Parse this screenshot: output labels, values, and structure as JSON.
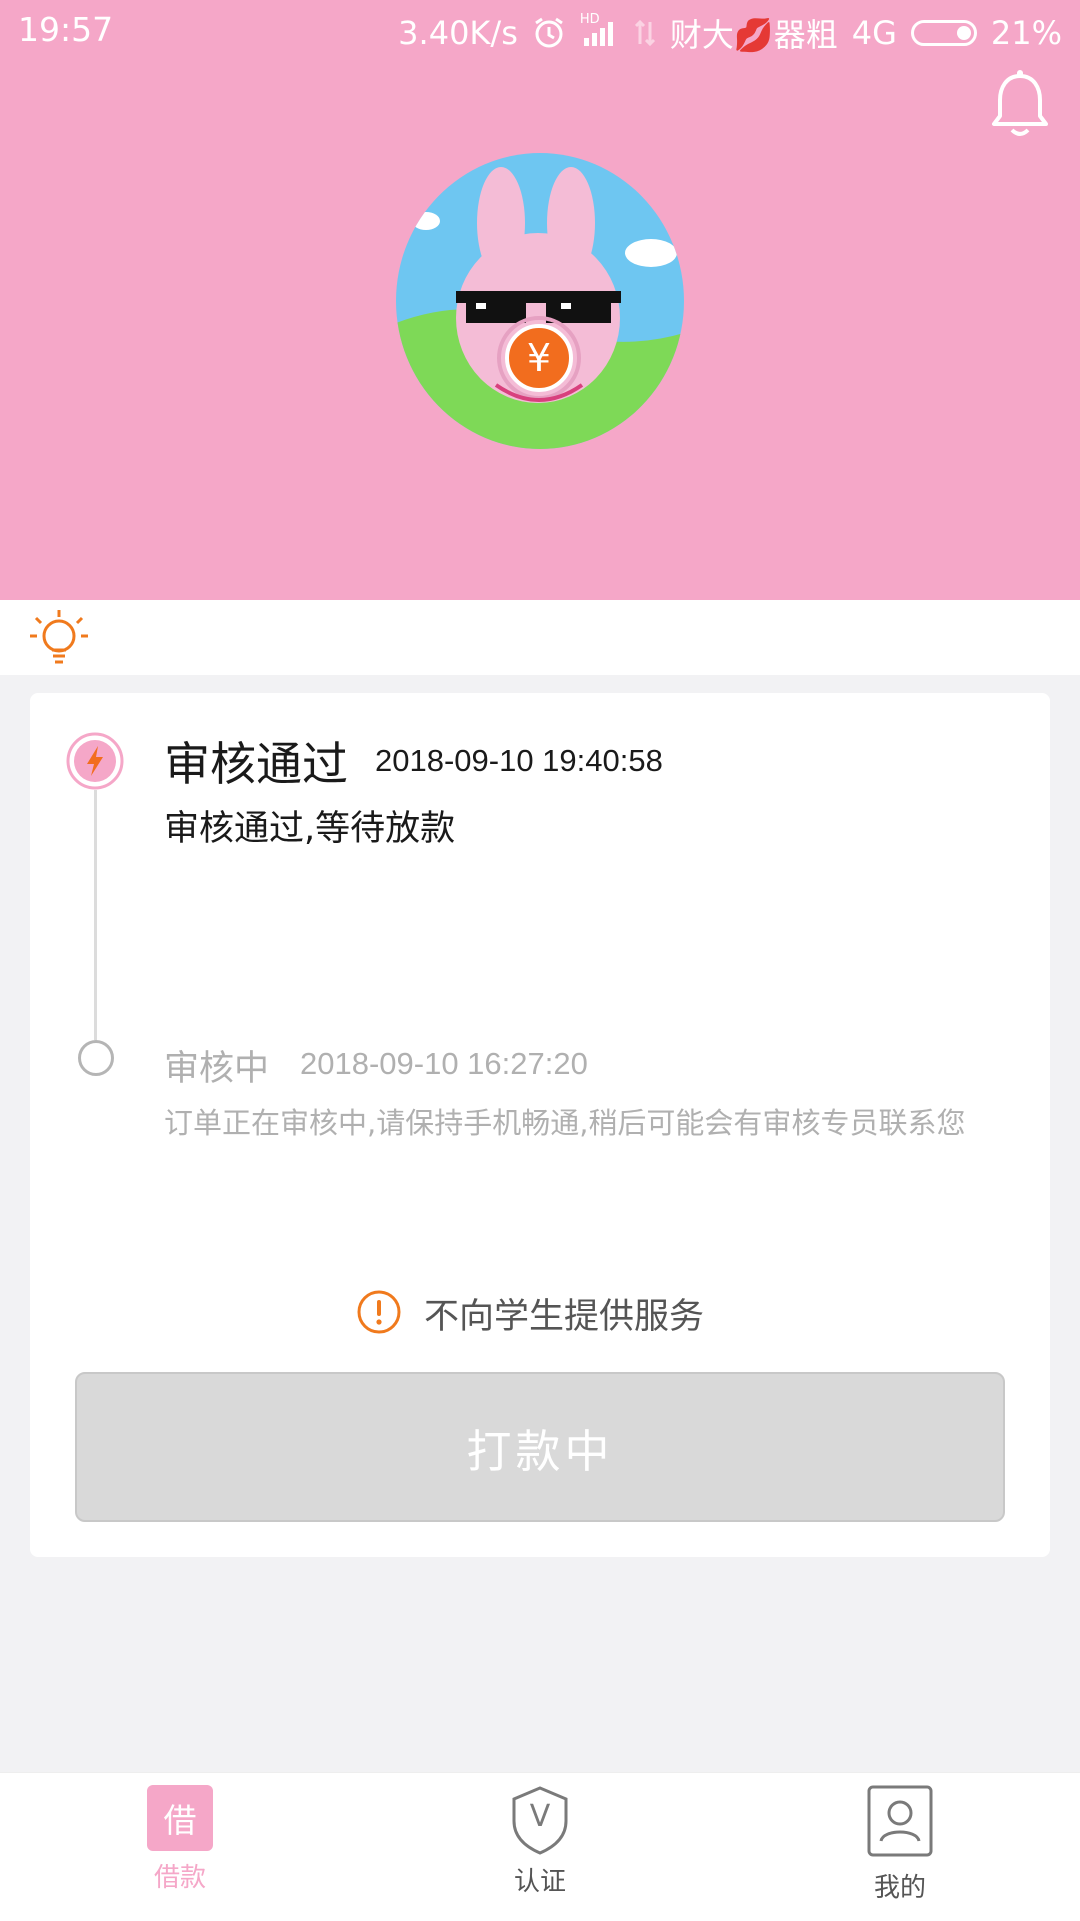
{
  "status_bar": {
    "time": "19:57",
    "net_speed": "3.40K/s",
    "carrier": "财大💋器粗",
    "network": "4G",
    "battery": "21%",
    "hd_label": "HD"
  },
  "header": {
    "bg_color": "#f5a7c8",
    "bell_icon": "bell-icon",
    "avatar_icon": "pig-mascot-with-sunglasses-and-yuan-coin",
    "yuan_symbol": "¥"
  },
  "tip_bar": {
    "icon": "lightbulb-icon"
  },
  "timeline": {
    "steps": [
      {
        "title": "审核通过",
        "time": "2018-09-10 19:40:58",
        "desc": "审核通过,等待放款",
        "status": "active",
        "icon": "lightning-icon"
      },
      {
        "title": "审核中",
        "time": "2018-09-10 16:27:20",
        "desc": "订单正在审核中,请保持手机畅通,稍后可能会有审核专员联系您",
        "status": "done"
      }
    ]
  },
  "notice": {
    "icon": "exclamation-circle-icon",
    "text": "不向学生提供服务"
  },
  "action_button": {
    "label": "打款中"
  },
  "bottom_nav": {
    "items": [
      {
        "label": "借款",
        "icon_text": "借",
        "active": true
      },
      {
        "label": "认证",
        "icon_text": "V",
        "active": false
      },
      {
        "label": "我的",
        "active": false
      }
    ],
    "active_color": "#f5a7c8",
    "inactive_color": "#555555"
  }
}
